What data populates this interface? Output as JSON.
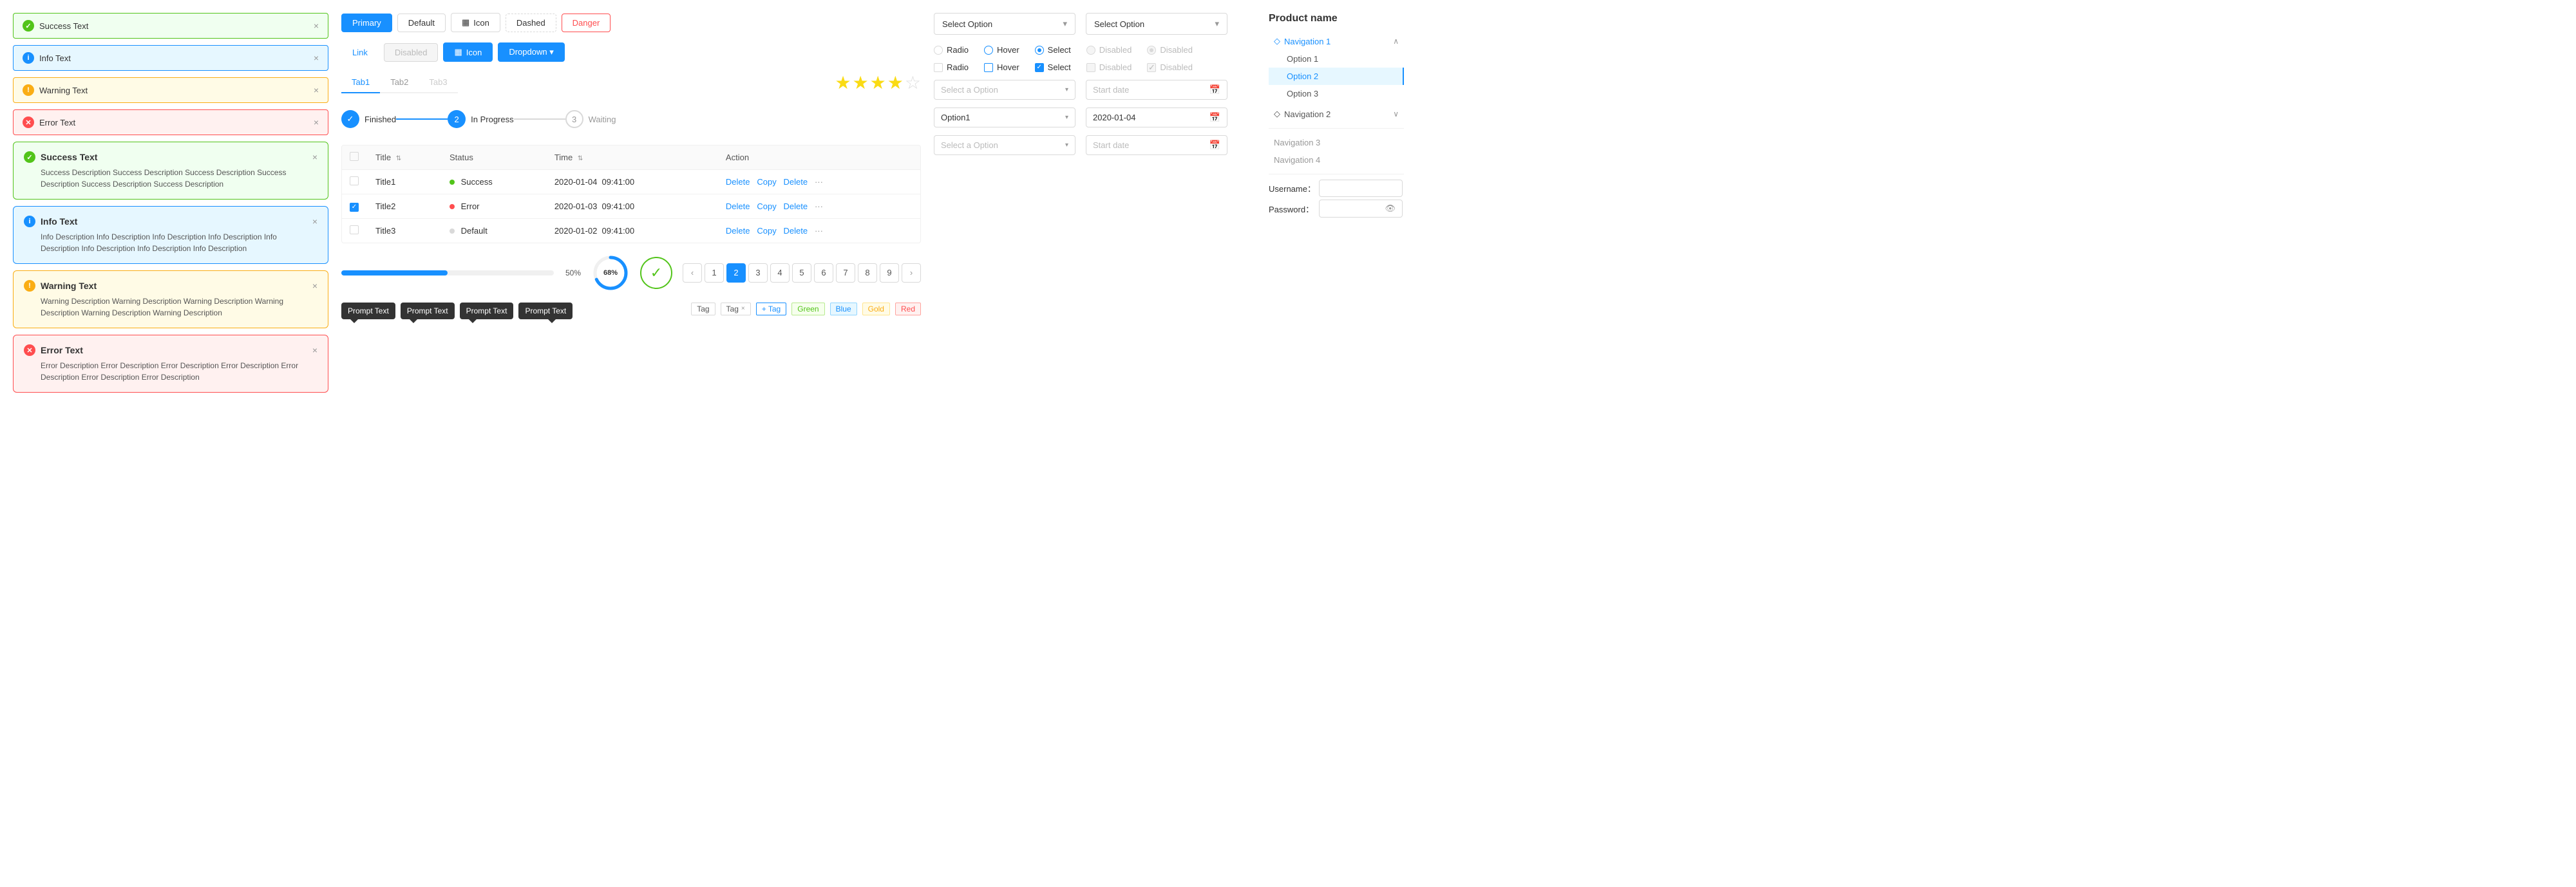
{
  "alerts": {
    "simple": [
      {
        "type": "success",
        "text": "Success Text",
        "iconSymbol": "✓"
      },
      {
        "type": "info",
        "text": "Info Text",
        "iconSymbol": "i"
      },
      {
        "type": "warning",
        "text": "Warning Text",
        "iconSymbol": "!"
      },
      {
        "type": "error",
        "text": "Error Text",
        "iconSymbol": "✕"
      }
    ],
    "detailed": [
      {
        "type": "success",
        "title": "Success Text",
        "iconSymbol": "✓",
        "desc": "Success Description Success Description Success Description Success Description Success Description Success Description"
      },
      {
        "type": "info",
        "title": "Info Text",
        "iconSymbol": "i",
        "desc": "Info Description Info Description Info Description Info Description Info Description Info Description Info Description Info Description"
      },
      {
        "type": "warning",
        "title": "Warning Text",
        "iconSymbol": "!",
        "desc": "Warning Description Warning Description Warning Description Warning Description Warning Description Warning Description"
      },
      {
        "type": "error",
        "title": "Error Text",
        "iconSymbol": "✕",
        "desc": "Error Description Error Description Error Description Error Description Error Description Error Description Error Description"
      }
    ]
  },
  "buttons": {
    "row1": [
      {
        "label": "Primary",
        "type": "primary"
      },
      {
        "label": "Default",
        "type": "default"
      },
      {
        "label": "Icon",
        "type": "icon",
        "icon": "▦"
      },
      {
        "label": "Dashed",
        "type": "dashed"
      },
      {
        "label": "Danger",
        "type": "danger"
      }
    ],
    "row2": [
      {
        "label": "Link",
        "type": "link"
      },
      {
        "label": "Disabled",
        "type": "disabled"
      },
      {
        "label": "Icon",
        "type": "icon-blue",
        "icon": "▦"
      },
      {
        "label": "Dropdown ▾",
        "type": "dropdown"
      }
    ]
  },
  "tabs": {
    "items": [
      {
        "label": "Tab1",
        "active": true
      },
      {
        "label": "Tab2",
        "active": false
      },
      {
        "label": "Tab3",
        "active": false,
        "disabled": true
      }
    ]
  },
  "stars": {
    "filled": 3,
    "half": 1,
    "empty": 1,
    "total": 5
  },
  "steps": [
    {
      "label": "Finished",
      "state": "done",
      "num": "✓"
    },
    {
      "label": "In Progress",
      "state": "active",
      "num": "2"
    },
    {
      "label": "Waiting",
      "state": "waiting",
      "num": "3"
    }
  ],
  "table": {
    "columns": [
      "",
      "Title ↕",
      "Status",
      "Time ↕",
      "Action"
    ],
    "rows": [
      {
        "checked": false,
        "title": "Title1",
        "status": "Success",
        "statusType": "success",
        "time": "2020-01-04  09:41:00"
      },
      {
        "checked": true,
        "title": "Title2",
        "status": "Error",
        "statusType": "error",
        "time": "2020-01-03  09:41:00"
      },
      {
        "checked": false,
        "title": "Title3",
        "status": "Default",
        "statusType": "default",
        "time": "2020-01-02  09:41:00"
      }
    ],
    "actions": [
      "Delete",
      "Copy",
      "Delete",
      "···"
    ]
  },
  "pagination": {
    "prev": "‹",
    "next": "›",
    "pages": [
      1,
      2,
      3,
      4,
      5,
      6,
      7,
      8,
      9
    ],
    "active": 2
  },
  "progress": {
    "bar_pct": 50,
    "bar_label": "50%",
    "circle_pct": 68,
    "circle_label": "68%",
    "check_done": true
  },
  "tooltips": [
    "Prompt Text",
    "Prompt Text",
    "Prompt Text",
    "Prompt Text"
  ],
  "tags": {
    "plain": [
      "Tag"
    ],
    "closable": [
      "Tag"
    ],
    "add_label": "+ Tag",
    "colored": [
      "Green",
      "Blue",
      "Gold",
      "Red"
    ]
  },
  "controls": {
    "row1": [
      {
        "label": "Radio",
        "type": "radio",
        "state": "unchecked"
      },
      {
        "label": "Hover",
        "type": "radio",
        "state": "hover"
      },
      {
        "label": "Select",
        "type": "radio",
        "state": "selected"
      },
      {
        "label": "Disabled",
        "type": "radio",
        "state": "disabled"
      },
      {
        "label": "Disabled",
        "type": "radio",
        "state": "disabled-selected"
      }
    ],
    "row2": [
      {
        "label": "Radio",
        "type": "checkbox",
        "state": "unchecked"
      },
      {
        "label": "Hover",
        "type": "checkbox",
        "state": "hover"
      },
      {
        "label": "Select",
        "type": "checkbox",
        "state": "selected"
      },
      {
        "label": "Disabled",
        "type": "checkbox",
        "state": "disabled"
      },
      {
        "label": "Disabled",
        "type": "checkbox",
        "state": "disabled-selected"
      }
    ]
  },
  "selects": [
    {
      "placeholder": "Select a Option",
      "value": null,
      "row": 1
    },
    {
      "placeholder": null,
      "value": "Option1",
      "row": 1
    },
    {
      "placeholder": "Select a Option",
      "value": null,
      "row": 2
    },
    {
      "placeholder": null,
      "value": null,
      "row": 2
    }
  ],
  "dates": [
    {
      "placeholder": "Start date",
      "value": null,
      "row": 1
    },
    {
      "placeholder": null,
      "value": "2020-01-04",
      "row": 1
    },
    {
      "placeholder": "Start date",
      "value": null,
      "row": 2
    },
    {
      "placeholder": null,
      "value": null,
      "row": 2
    }
  ],
  "dropdown_labels": {
    "select_option": "Select Option",
    "select_option2": "Select Option"
  },
  "navigation": {
    "title": "Product name",
    "sections": [
      {
        "label": "Navigation 1",
        "icon": "◇",
        "expanded": true,
        "items": [
          "Option 1",
          "Option 2",
          "Option 3"
        ]
      },
      {
        "label": "Navigation 2",
        "icon": "◇",
        "expanded": false,
        "items": []
      }
    ],
    "items": [
      {
        "label": "Navigation 3"
      },
      {
        "label": "Navigation 4"
      }
    ],
    "form": {
      "username_label": "Username：",
      "password_label": "Password："
    }
  }
}
